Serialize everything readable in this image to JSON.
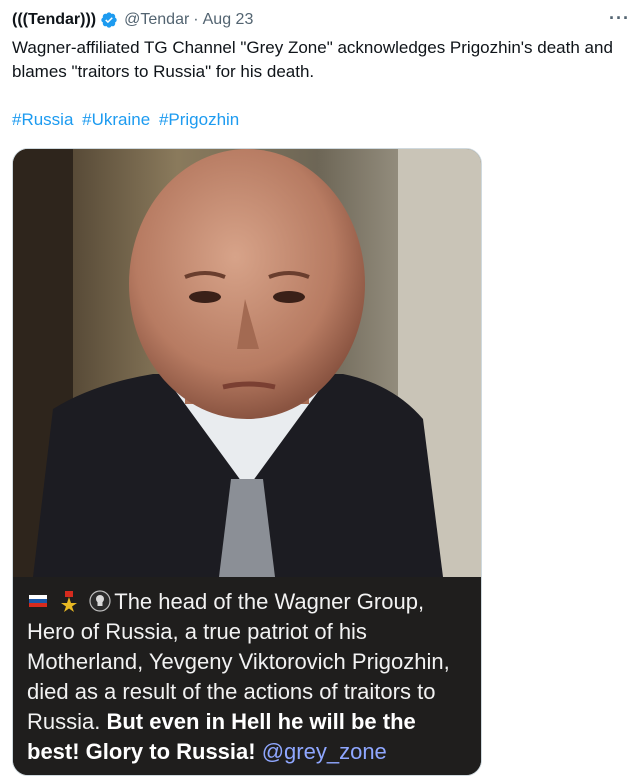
{
  "tweet": {
    "display_name": "(((Tendar)))",
    "handle": "@Tendar",
    "separator": "·",
    "date": "Aug 23",
    "more": "···",
    "text": "Wagner-affiliated TG Channel \"Grey Zone\" acknowledges Prigozhin's death and blames \"traitors to Russia\" for his death.",
    "hashtags": [
      "#Russia",
      "#Ukraine",
      "#Prigozhin"
    ]
  },
  "media": {
    "caption_text": "The head of the Wagner Group, Hero of Russia, a true patriot of his Motherland, Yevgeny Viktorovich Prigozhin, died as a result of the actions of traitors to Russia.",
    "caption_bold": "But even in Hell he will be the best! Glory to Russia!",
    "caption_mention": "@grey_zone",
    "emojis": [
      "russian-flag-icon",
      "hero-star-medal-icon",
      "wagner-skull-emblem-icon"
    ]
  },
  "colors": {
    "link": "#1d9bf0",
    "muted": "#536471",
    "verified": "#1d9bf0"
  }
}
